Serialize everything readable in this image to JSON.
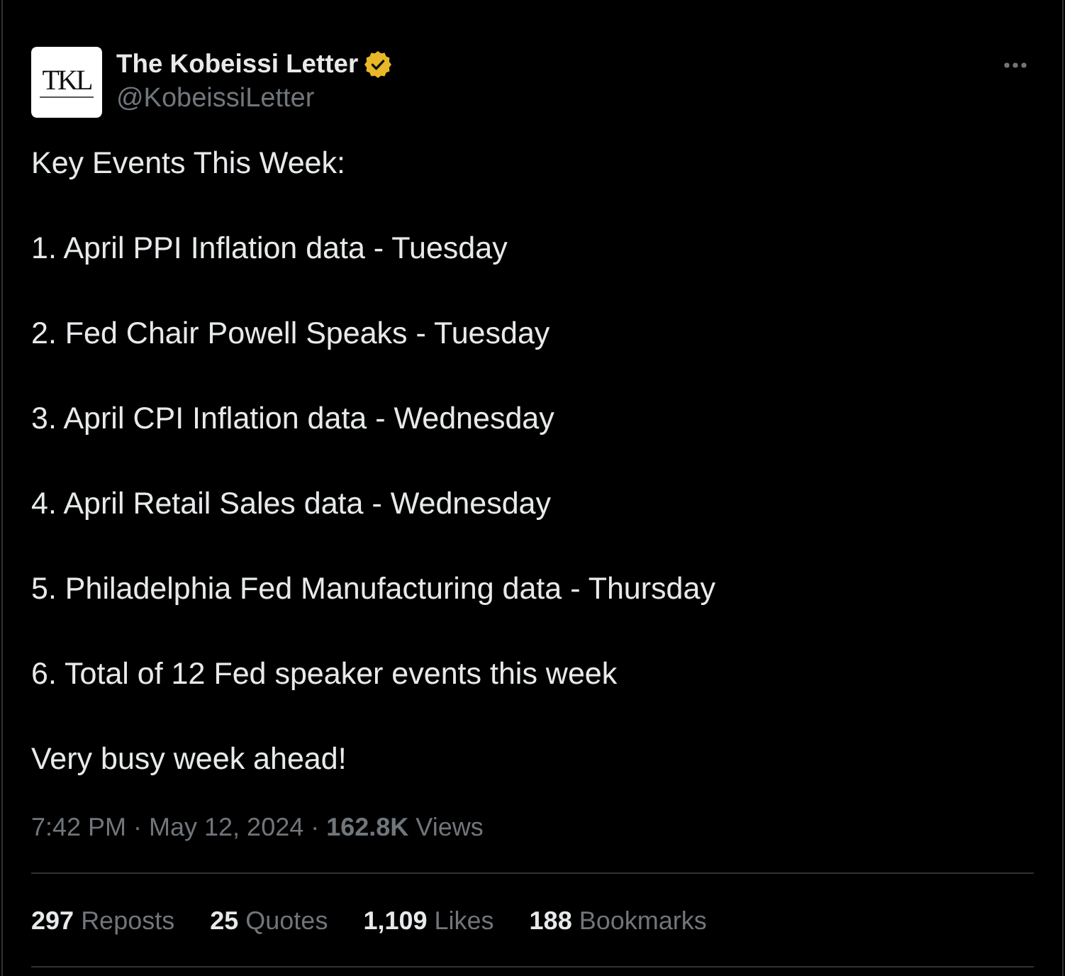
{
  "tweet": {
    "author": {
      "logo_text": "TKL",
      "name": "The Kobeissi Letter",
      "verified": true,
      "handle": "@KobeissiLetter"
    },
    "paragraphs": [
      "Key Events This Week:",
      "1. April PPI Inflation data - Tuesday",
      "2. Fed Chair Powell Speaks - Tuesday",
      "3. April CPI Inflation data - Wednesday",
      "4. April Retail Sales data - Wednesday",
      "5. Philadelphia Fed Manufacturing data - Thursday",
      "6. Total of 12 Fed speaker events this week",
      "Very busy week ahead!"
    ],
    "meta": "7:42 PM · May 12, 2024 · **162.8K** Views",
    "stats": [
      {
        "count": "297",
        "label": "Reposts"
      },
      {
        "count": "25",
        "label": "Quotes"
      },
      {
        "count": "1,109",
        "label": "Likes"
      },
      {
        "count": "188",
        "label": "Bookmarks"
      }
    ]
  }
}
